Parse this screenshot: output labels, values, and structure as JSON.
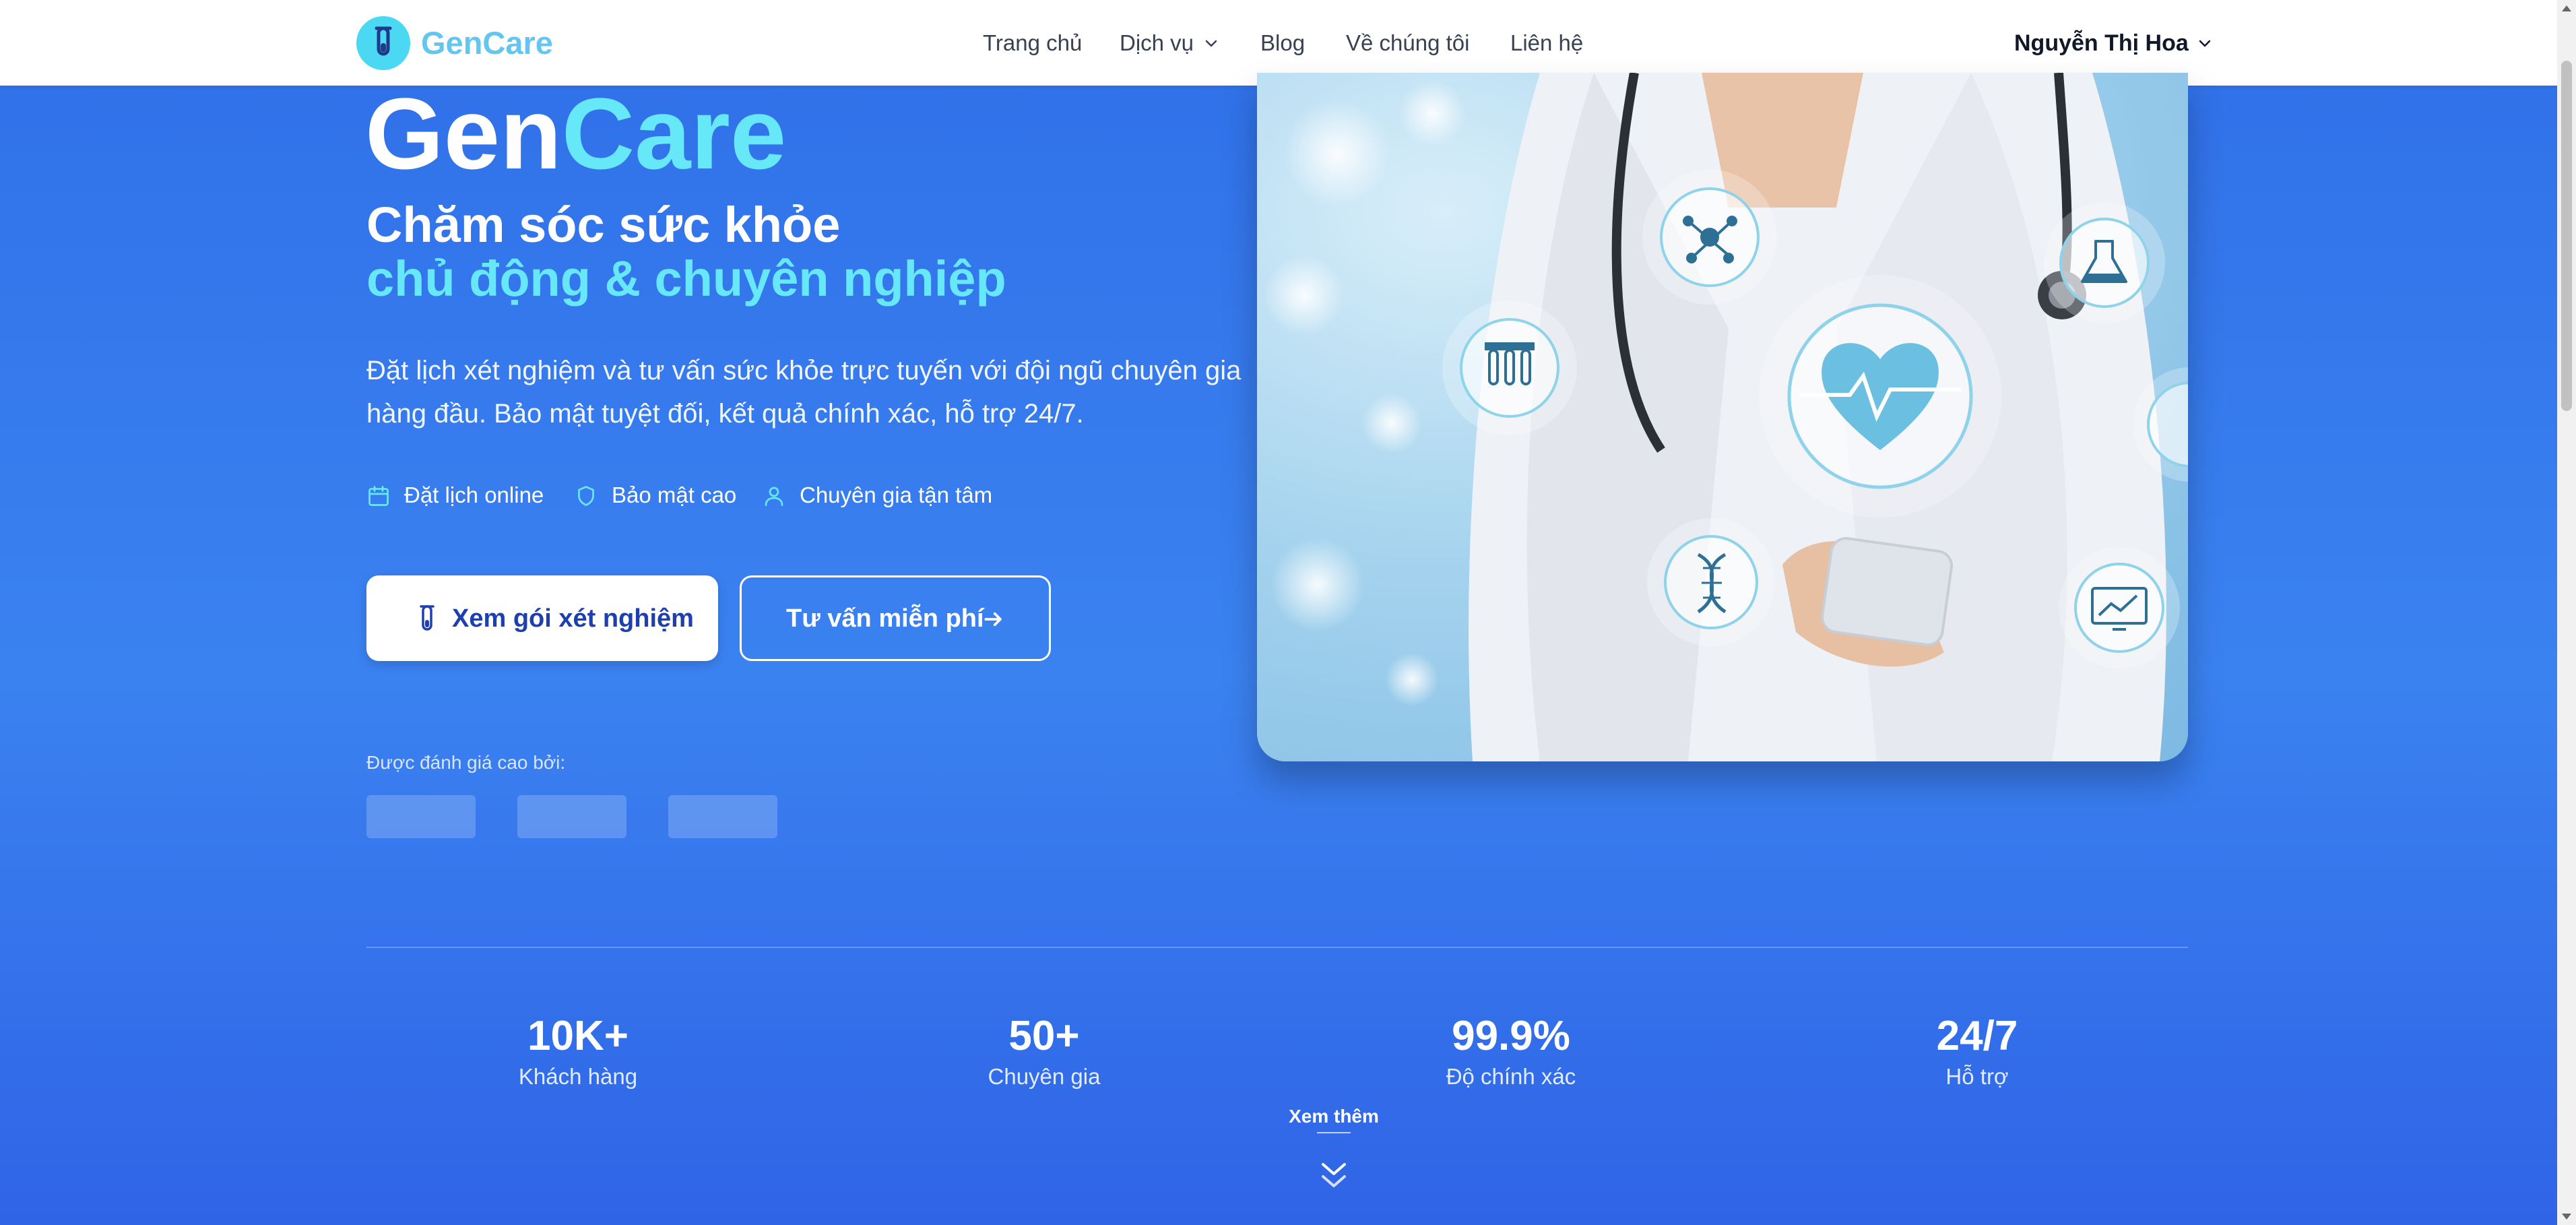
{
  "header": {
    "brand": "GenCare",
    "nav": {
      "home": "Trang chủ",
      "services": "Dịch vụ",
      "blog": "Blog",
      "about": "Về chúng tôi",
      "contact": "Liên hệ"
    },
    "user_name": "Nguyễn Thị Hoa"
  },
  "hero": {
    "title_part1": "Gen",
    "title_part2": "Care",
    "subtitle_line1": "Chăm sóc sức khỏe",
    "subtitle_line2": "chủ động & chuyên nghiệp",
    "description": "Đặt lịch xét nghiệm và tư vấn sức khỏe trực tuyến với đội ngũ chuyên gia hàng đầu. Bảo mật tuyệt đối, kết quả chính xác, hỗ trợ 24/7.",
    "features": [
      {
        "icon": "calendar-icon",
        "label": "Đặt lịch online"
      },
      {
        "icon": "shield-icon",
        "label": "Bảo mật cao"
      },
      {
        "icon": "user-icon",
        "label": "Chuyên gia tận tâm"
      }
    ],
    "primary_button": "Xem gói xét nghiệm",
    "secondary_button": "Tư vấn miễn phí",
    "rated_by": "Được đánh giá cao bởi:"
  },
  "stats": [
    {
      "value": "10K+",
      "label": "Khách hàng"
    },
    {
      "value": "50+",
      "label": "Chuyên gia"
    },
    {
      "value": "99.9%",
      "label": "Độ chính xác"
    },
    {
      "value": "24/7",
      "label": "Hỗ trợ"
    }
  ],
  "see_more": "Xem thêm",
  "colors": {
    "brand": "#62c6f0",
    "accent_cyan": "#67e8f9",
    "hero_blue": "#3b82f1",
    "button_text": "#1e40af"
  }
}
